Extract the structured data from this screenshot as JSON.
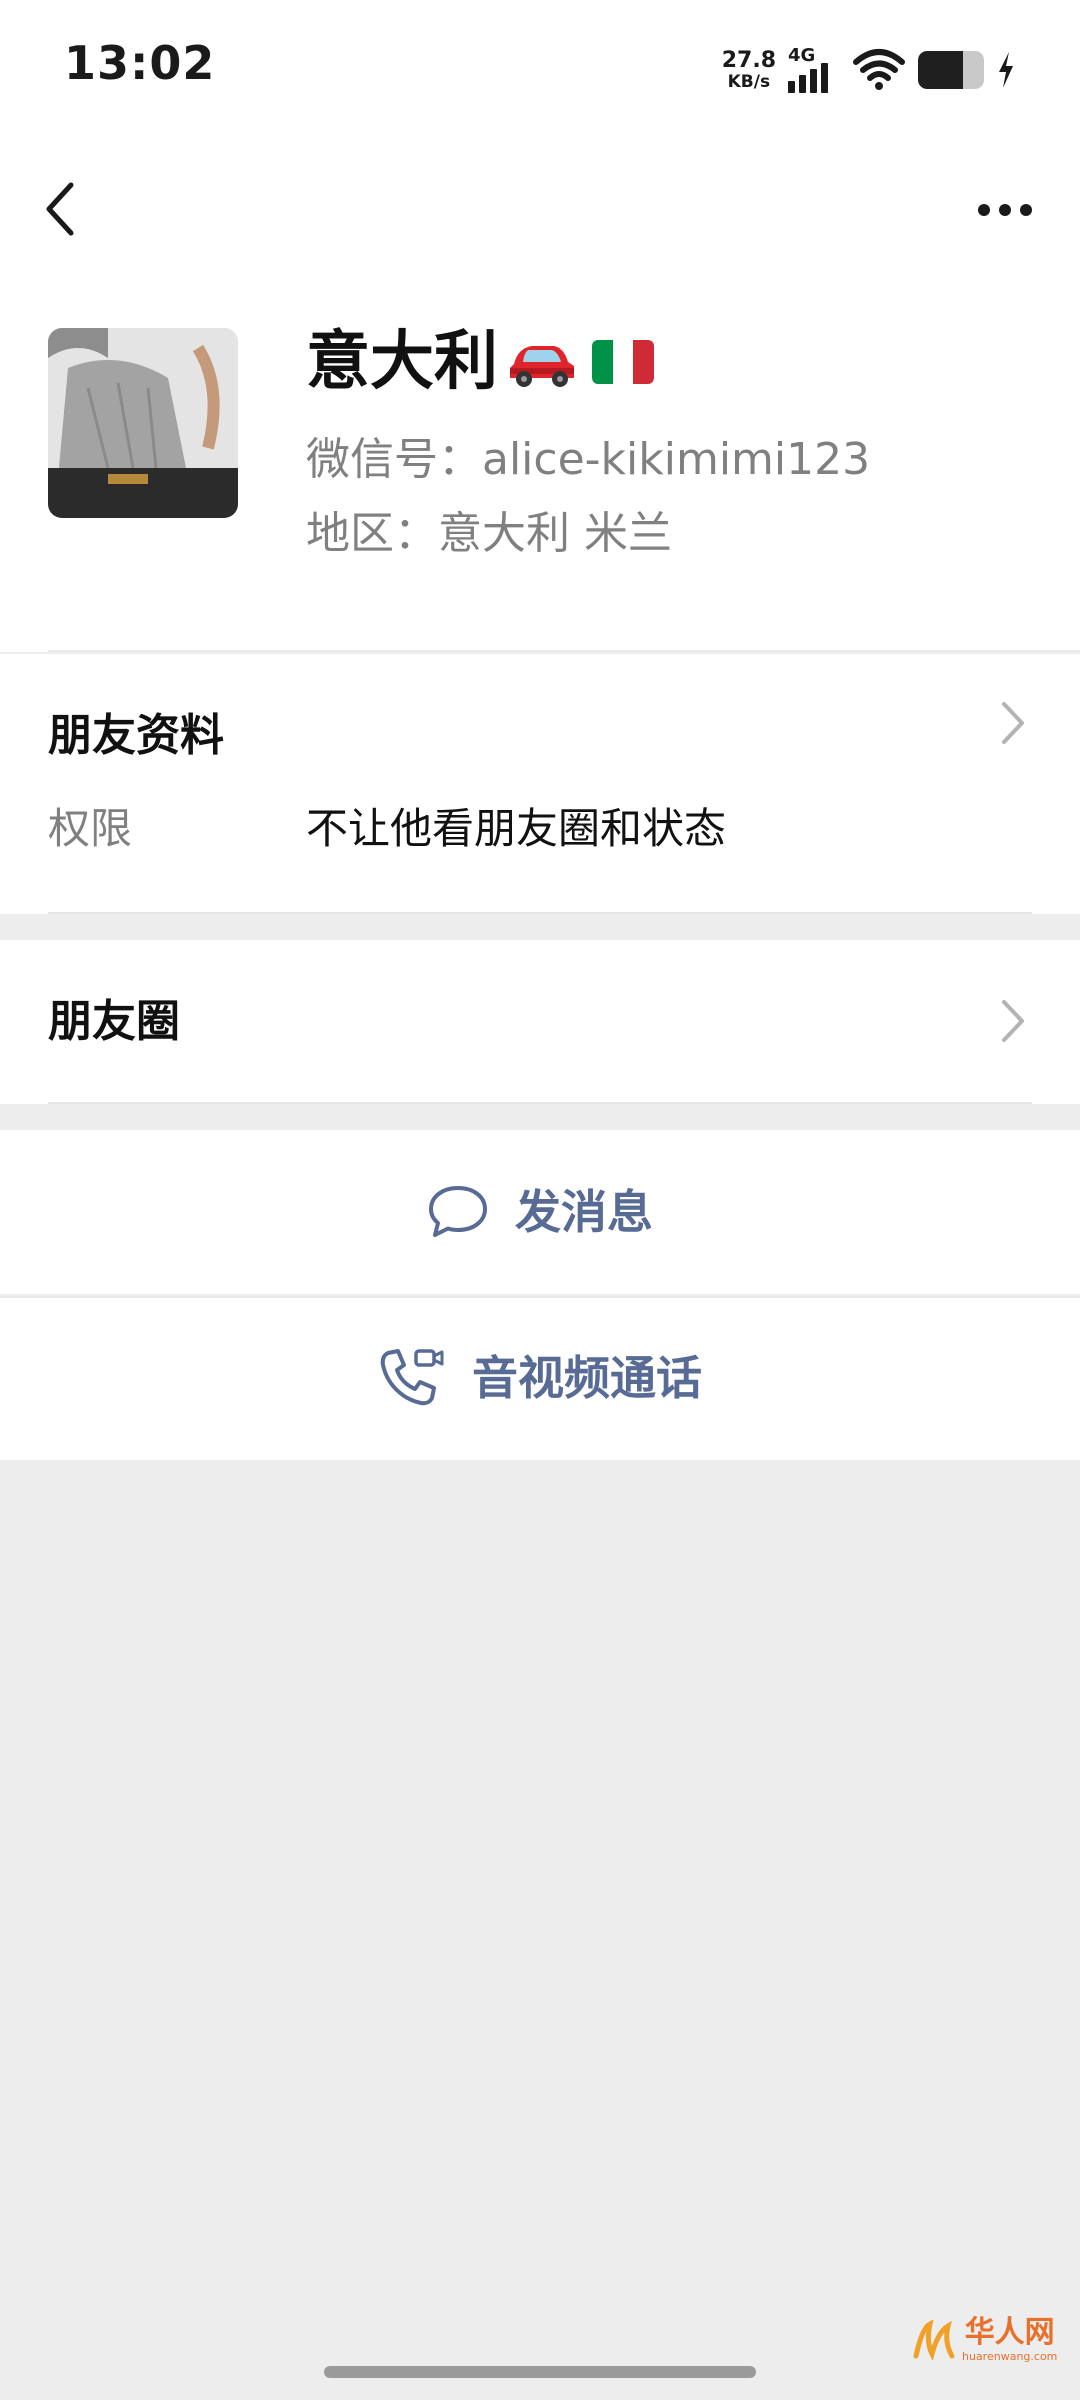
{
  "status_bar": {
    "time": "13:02",
    "net_speed_value": "27.8",
    "net_speed_unit": "KB/s",
    "network_type": "4G",
    "battery_level": 0.68
  },
  "header": {
    "back_icon": "chevron-left-icon",
    "more_icon": "more-horizontal-icon"
  },
  "profile": {
    "nickname": "意大利",
    "nickname_emojis": [
      "car-emoji",
      "italy-flag-emoji"
    ],
    "wechat_id_line": "微信号：alice-kikimimi123",
    "region_line": "地区：意大利  米兰"
  },
  "friend_info": {
    "title": "朋友资料",
    "permission_label": "权限",
    "permission_value": "不让他看朋友圈和状态"
  },
  "moments": {
    "title": "朋友圈"
  },
  "actions": {
    "send_message": "发消息",
    "video_call": "音视频通话"
  },
  "watermark": {
    "name": "华人网",
    "url": "huarenwang.com"
  },
  "colors": {
    "link_blue": "#576b95",
    "background": "#ededed",
    "watermark_orange": "#e8702a",
    "italy_green": "#009246",
    "italy_white": "#ffffff",
    "italy_red": "#ce2b37"
  }
}
